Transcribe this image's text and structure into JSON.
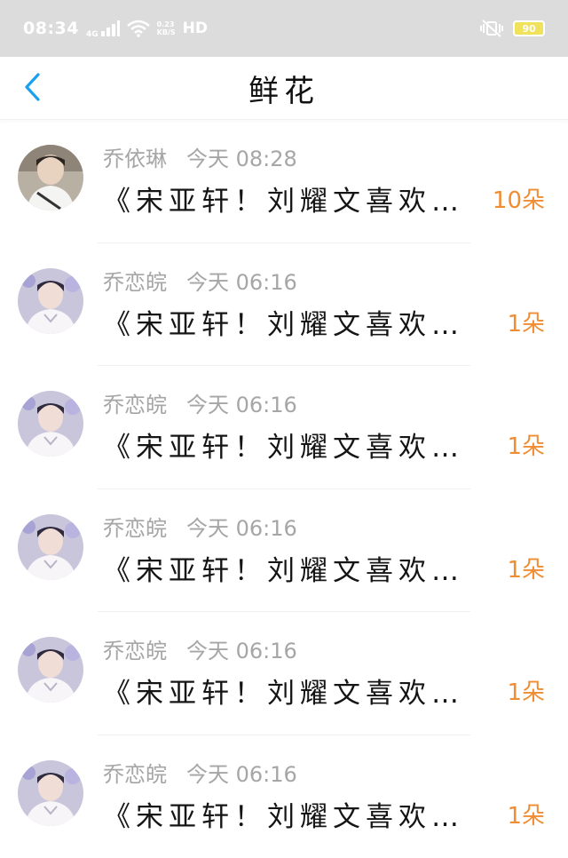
{
  "status_bar": {
    "time": "08:34",
    "network": "4G",
    "speed_value": "0.23",
    "speed_unit": "KB/S",
    "hd": "HD",
    "battery": "90"
  },
  "header": {
    "title": "鲜花"
  },
  "colors": {
    "accent_blue": "#1aa0f0",
    "count_orange": "#f08d33",
    "name_gray": "#a6a6a6"
  },
  "rows": [
    {
      "name": "乔依琳",
      "time": "今天 08:28",
      "message": "《宋亚轩！刘耀文喜欢…",
      "count": "10朵"
    },
    {
      "name": "乔恋皖",
      "time": "今天 06:16",
      "message": "《宋亚轩！刘耀文喜欢…",
      "count": "1朵"
    },
    {
      "name": "乔恋皖",
      "time": "今天 06:16",
      "message": "《宋亚轩！刘耀文喜欢…",
      "count": "1朵"
    },
    {
      "name": "乔恋皖",
      "time": "今天 06:16",
      "message": "《宋亚轩！刘耀文喜欢…",
      "count": "1朵"
    },
    {
      "name": "乔恋皖",
      "time": "今天 06:16",
      "message": "《宋亚轩！刘耀文喜欢…",
      "count": "1朵"
    },
    {
      "name": "乔恋皖",
      "time": "今天 06:16",
      "message": "《宋亚轩！刘耀文喜欢…",
      "count": "1朵"
    }
  ]
}
